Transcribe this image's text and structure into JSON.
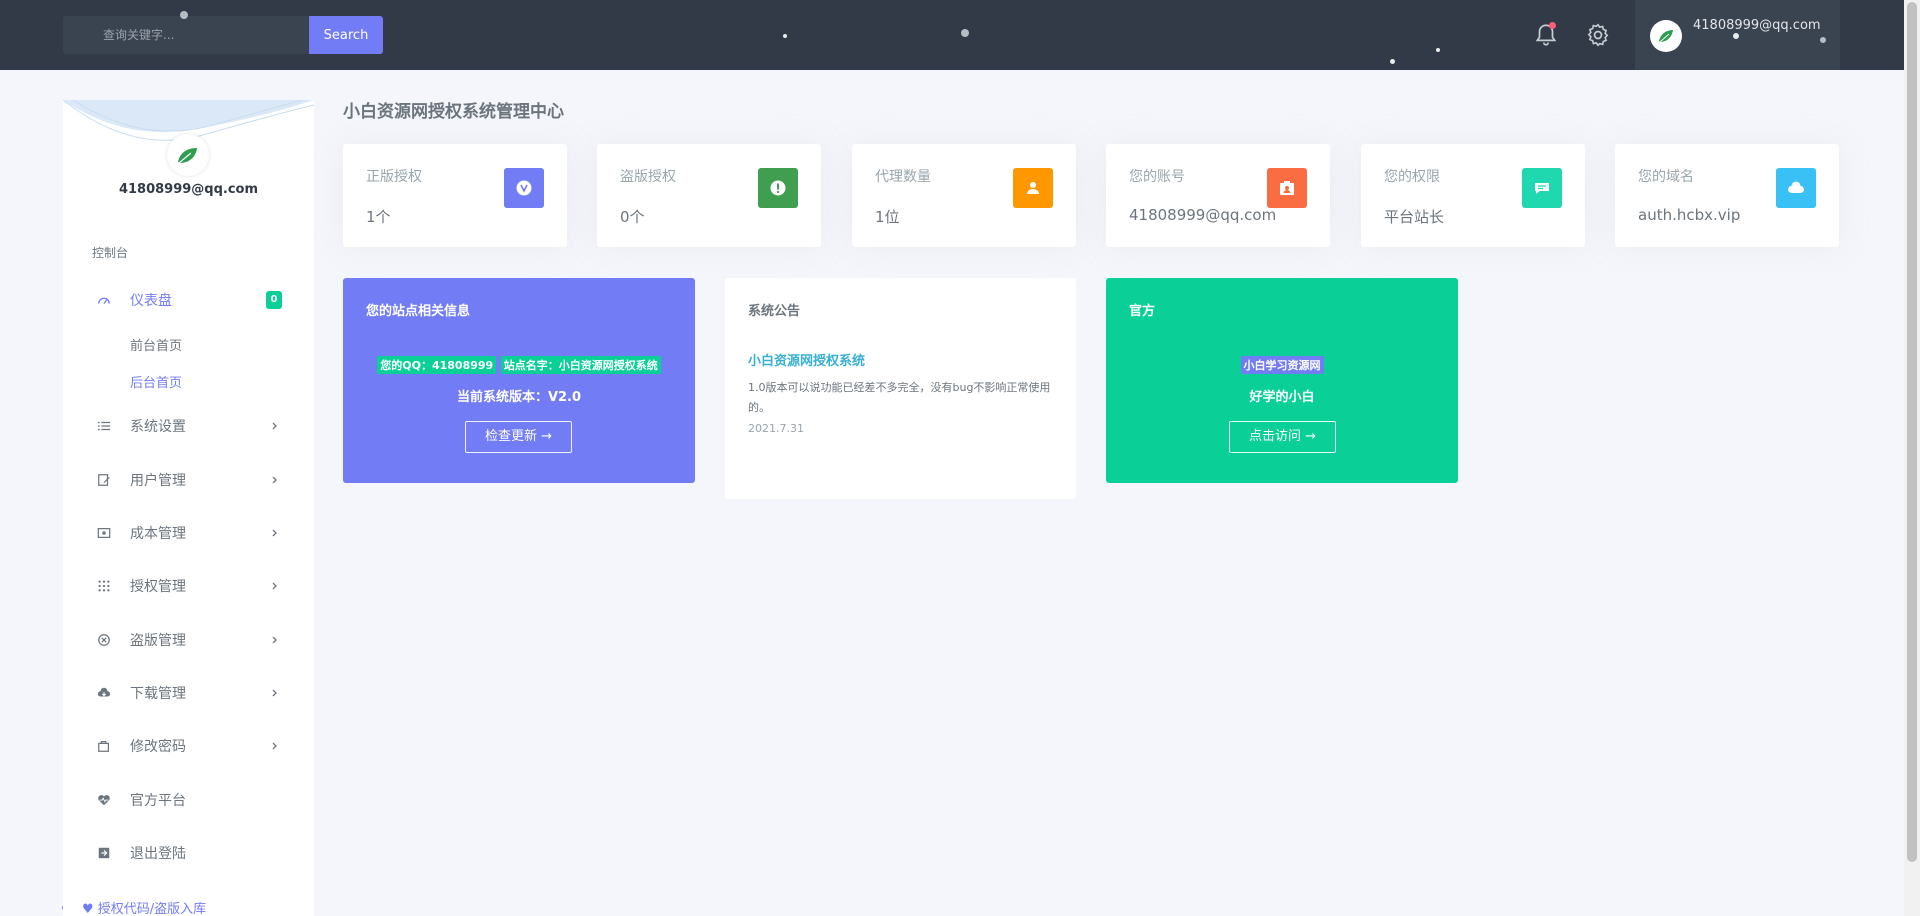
{
  "topbar": {
    "search_placeholder": "查询关键字...",
    "search_button": "Search",
    "user_email": "41808999@qq.com"
  },
  "sidebar": {
    "user_email": "41808999@qq.com",
    "section_title": "控制台",
    "dashboard": {
      "label": "仪表盘",
      "badge": "0"
    },
    "sub_items": [
      "前台首页",
      "后台首页"
    ],
    "items": [
      {
        "label": "系统设置",
        "icon": "list-icon"
      },
      {
        "label": "用户管理",
        "icon": "edit-icon"
      },
      {
        "label": "成本管理",
        "icon": "cash-icon"
      },
      {
        "label": "授权管理",
        "icon": "grid-icon"
      },
      {
        "label": "盗版管理",
        "icon": "close-circle-icon"
      },
      {
        "label": "下载管理",
        "icon": "cloud-download-icon"
      },
      {
        "label": "修改密码",
        "icon": "briefcase-icon"
      },
      {
        "label": "官方平台",
        "icon": "heart-pulse-icon"
      },
      {
        "label": "退出登陆",
        "icon": "exit-icon"
      }
    ],
    "footer_link": "授权代码/盗版入库"
  },
  "main": {
    "title": "小白资源网授权系统管理中心",
    "stats": [
      {
        "label": "正版授权",
        "value": "1个",
        "color": "#727cf5",
        "icon": "v-badge-icon"
      },
      {
        "label": "盗版授权",
        "value": "0个",
        "color": "#3f9e50",
        "icon": "exclamation-icon"
      },
      {
        "label": "代理数量",
        "value": "1位",
        "color": "#ff9800",
        "icon": "user-icon"
      },
      {
        "label": "您的账号",
        "value": "41808999@qq.com",
        "color": "#fa6d42",
        "icon": "id-card-icon"
      },
      {
        "label": "您的权限",
        "value": "平台站长",
        "color": "#1fd8b0",
        "icon": "chat-icon"
      },
      {
        "label": "您的域名",
        "value": "auth.hcbx.vip",
        "color": "#39c0f5",
        "icon": "cloud-icon"
      }
    ],
    "site_info": {
      "title": "您的站点相关信息",
      "qq_chip": "您的QQ：41808999",
      "name_chip": "站点名字：小白资源网授权系统",
      "version": "当前系统版本：V2.0",
      "button": "检查更新"
    },
    "notice": {
      "title": "系统公告",
      "link": "小白资源网授权系统",
      "text": "1.0版本可以说功能已经差不多完全，没有bug不影响正常使用的。",
      "date": "2021.7.31"
    },
    "official": {
      "title": "官方",
      "chip": "小白学习资源网",
      "subtitle": "好学的小白",
      "button": "点击访问"
    }
  },
  "colors": {
    "topbar": "#313a46",
    "primary": "#727cf5",
    "success": "#0acf97",
    "info": "#39afd1"
  }
}
